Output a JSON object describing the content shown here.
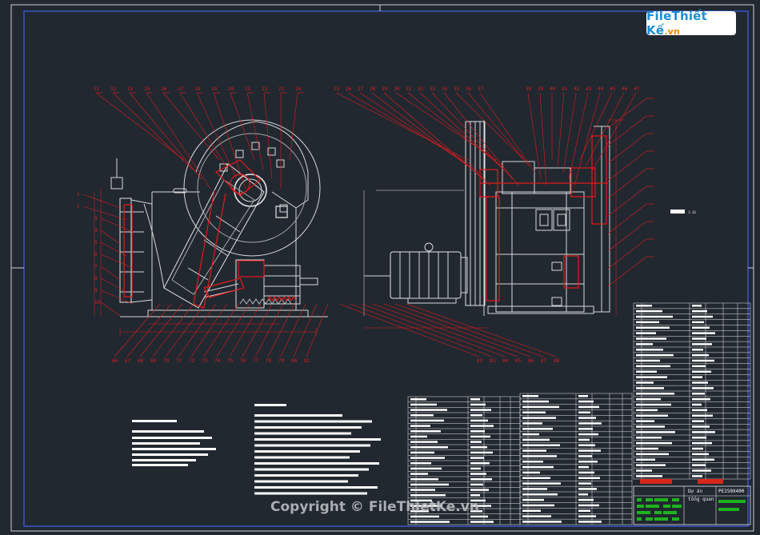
{
  "watermark": {
    "logo_main": "File",
    "logo_brand": "Thiết Kế",
    "logo_tld": ".vn",
    "copyright": "Copyright © FileThietKe.vn"
  },
  "title_block": {
    "drawing_code": "PE250X400",
    "name_line1": "Dự án",
    "name_line2": "tổng quan"
  },
  "colors": {
    "background": "#212830",
    "frame": "#3b56c9",
    "leader": "#e31b1b",
    "object": "#d8d8d8",
    "table_line": "#e6e6e6",
    "title_green": "#1eb31e",
    "title_red": "#d9261c"
  },
  "balloons_left_view": [
    "11",
    "12",
    "13",
    "15",
    "16",
    "17",
    "18",
    "19",
    "20",
    "21",
    "22",
    "23",
    "24",
    "1",
    "2",
    "3",
    "4",
    "5",
    "6",
    "7",
    "8",
    "9",
    "10"
  ],
  "balloons_right_view": [
    "25",
    "26",
    "27",
    "28",
    "29",
    "30",
    "31",
    "32",
    "33",
    "34",
    "35",
    "36",
    "37",
    "38",
    "39",
    "40",
    "41",
    "42",
    "43",
    "44",
    "45",
    "46",
    "47"
  ],
  "balloons_bottom": [
    "66",
    "67",
    "68",
    "69",
    "70",
    "71",
    "72",
    "73",
    "74",
    "75",
    "76",
    "77",
    "78",
    "79",
    "80",
    "81",
    "82",
    "83",
    "84",
    "85",
    "86",
    "87",
    "88"
  ]
}
